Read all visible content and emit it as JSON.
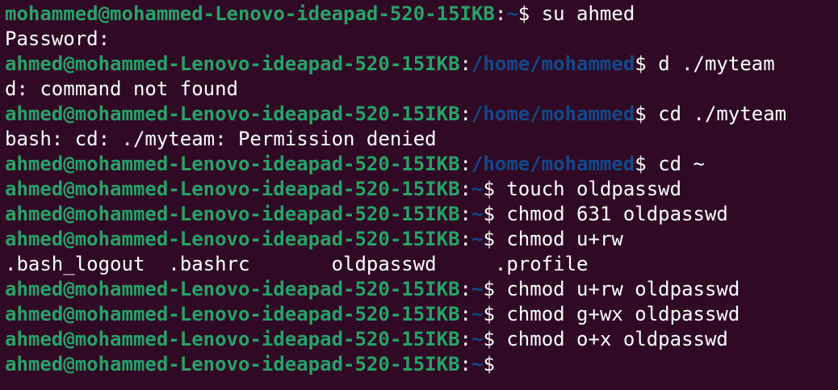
{
  "terminal": {
    "colors": {
      "background": "#300a24",
      "prompt_user": "#26a269",
      "prompt_path": "#12488b",
      "text": "#ffffff"
    },
    "lines": [
      {
        "type": "prompt",
        "user": "mohammed@mohammed-Lenovo-ideapad-520-15IKB",
        "path": "~",
        "command": "su ahmed"
      },
      {
        "type": "output",
        "text": "Password:"
      },
      {
        "type": "prompt",
        "user": "ahmed@mohammed-Lenovo-ideapad-520-15IKB",
        "path": "/home/mohammed",
        "command": "d ./myteam"
      },
      {
        "type": "output",
        "text": "d: command not found"
      },
      {
        "type": "prompt",
        "user": "ahmed@mohammed-Lenovo-ideapad-520-15IKB",
        "path": "/home/mohammed",
        "command": "cd ./myteam"
      },
      {
        "type": "output",
        "text": "bash: cd: ./myteam: Permission denied"
      },
      {
        "type": "prompt",
        "user": "ahmed@mohammed-Lenovo-ideapad-520-15IKB",
        "path": "/home/mohammed",
        "command": "cd ~"
      },
      {
        "type": "prompt",
        "user": "ahmed@mohammed-Lenovo-ideapad-520-15IKB",
        "path": "~",
        "command": "touch oldpasswd"
      },
      {
        "type": "prompt",
        "user": "ahmed@mohammed-Lenovo-ideapad-520-15IKB",
        "path": "~",
        "command": "chmod 631 oldpasswd"
      },
      {
        "type": "prompt",
        "user": "ahmed@mohammed-Lenovo-ideapad-520-15IKB",
        "path": "~",
        "command": "chmod u+rw"
      },
      {
        "type": "output",
        "text": ".bash_logout  .bashrc       oldpasswd     .profile"
      },
      {
        "type": "prompt",
        "user": "ahmed@mohammed-Lenovo-ideapad-520-15IKB",
        "path": "~",
        "command": "chmod u+rw oldpasswd"
      },
      {
        "type": "prompt",
        "user": "ahmed@mohammed-Lenovo-ideapad-520-15IKB",
        "path": "~",
        "command": "chmod g+wx oldpasswd"
      },
      {
        "type": "prompt",
        "user": "ahmed@mohammed-Lenovo-ideapad-520-15IKB",
        "path": "~",
        "command": "chmod o+x oldpasswd"
      },
      {
        "type": "prompt",
        "user": "ahmed@mohammed-Lenovo-ideapad-520-15IKB",
        "path": "~",
        "command": ""
      }
    ]
  }
}
